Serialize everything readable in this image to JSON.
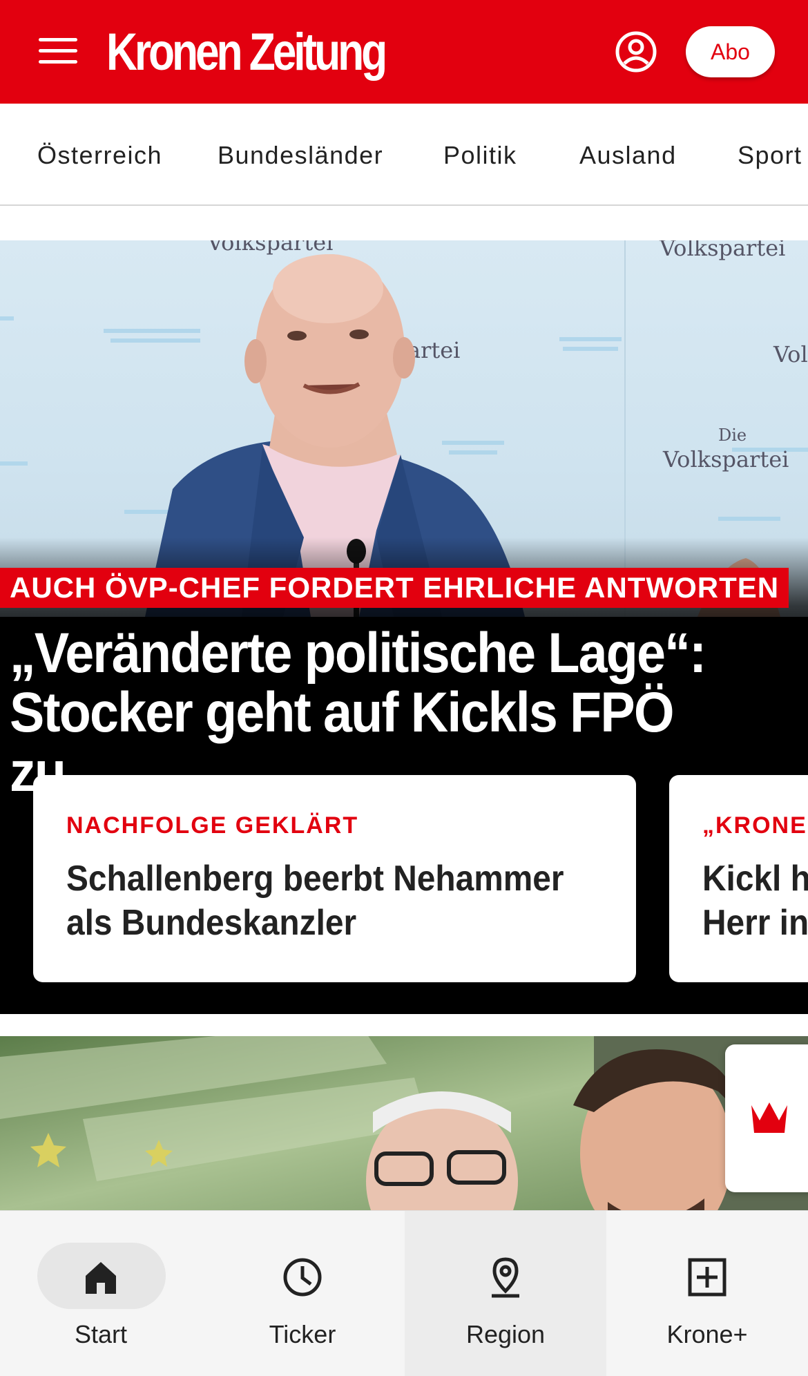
{
  "header": {
    "logo_text": "Kronen Zeitung",
    "abo_label": "Abo",
    "brand_color": "#e2000f",
    "icons": [
      "hamburger-menu-icon",
      "user-account-icon"
    ]
  },
  "categories": [
    "Österreich",
    "Bundesländer",
    "Politik",
    "Ausland",
    "Sport"
  ],
  "hero": {
    "kicker": "AUCH ÖVP-CHEF FORDERT EHRLICHE ANTWORTEN",
    "headline_line1": "„Veränderte politische Lage“:",
    "headline_line2": "Stocker geht auf Kickls FPÖ zu",
    "backdrop_texts": [
      "Volkspartei",
      "Volkspartei",
      "artei",
      "Vol",
      "Die",
      "Volkspartei"
    ],
    "cards": [
      {
        "kicker": "NACHFOLGE GEKLÄRT",
        "title_line1": "Schallenberg beerbt Nehammer",
        "title_line2": "als Bundeskanzler"
      },
      {
        "kicker": "„KRONE“",
        "title_line1": "Kickl h",
        "title_line2": "Herr in"
      }
    ]
  },
  "floating": {
    "icon": "krone-crown-icon"
  },
  "bottom_nav": [
    {
      "label": "Start",
      "icon": "home-icon",
      "selected": true
    },
    {
      "label": "Ticker",
      "icon": "clock-icon",
      "selected": false
    },
    {
      "label": "Region",
      "icon": "location-pin-icon",
      "selected": false
    },
    {
      "label": "Krone+",
      "icon": "plus-box-icon",
      "selected": false
    }
  ]
}
